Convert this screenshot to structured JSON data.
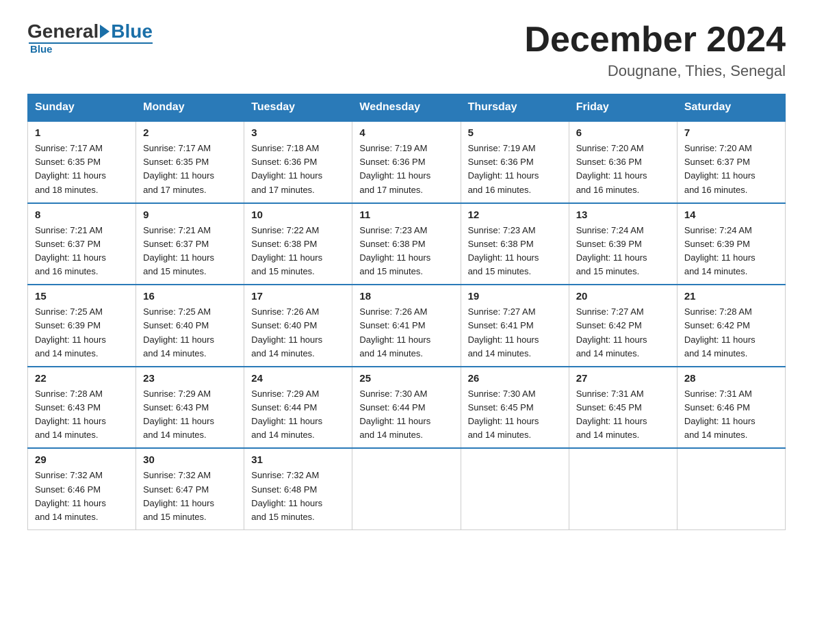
{
  "logo": {
    "general": "General",
    "blue": "Blue",
    "underline": "Blue"
  },
  "header": {
    "title": "December 2024",
    "location": "Dougnane, Thies, Senegal"
  },
  "days_of_week": [
    "Sunday",
    "Monday",
    "Tuesday",
    "Wednesday",
    "Thursday",
    "Friday",
    "Saturday"
  ],
  "weeks": [
    [
      {
        "day": "1",
        "sunrise": "7:17 AM",
        "sunset": "6:35 PM",
        "daylight": "11 hours and 18 minutes."
      },
      {
        "day": "2",
        "sunrise": "7:17 AM",
        "sunset": "6:35 PM",
        "daylight": "11 hours and 17 minutes."
      },
      {
        "day": "3",
        "sunrise": "7:18 AM",
        "sunset": "6:36 PM",
        "daylight": "11 hours and 17 minutes."
      },
      {
        "day": "4",
        "sunrise": "7:19 AM",
        "sunset": "6:36 PM",
        "daylight": "11 hours and 17 minutes."
      },
      {
        "day": "5",
        "sunrise": "7:19 AM",
        "sunset": "6:36 PM",
        "daylight": "11 hours and 16 minutes."
      },
      {
        "day": "6",
        "sunrise": "7:20 AM",
        "sunset": "6:36 PM",
        "daylight": "11 hours and 16 minutes."
      },
      {
        "day": "7",
        "sunrise": "7:20 AM",
        "sunset": "6:37 PM",
        "daylight": "11 hours and 16 minutes."
      }
    ],
    [
      {
        "day": "8",
        "sunrise": "7:21 AM",
        "sunset": "6:37 PM",
        "daylight": "11 hours and 16 minutes."
      },
      {
        "day": "9",
        "sunrise": "7:21 AM",
        "sunset": "6:37 PM",
        "daylight": "11 hours and 15 minutes."
      },
      {
        "day": "10",
        "sunrise": "7:22 AM",
        "sunset": "6:38 PM",
        "daylight": "11 hours and 15 minutes."
      },
      {
        "day": "11",
        "sunrise": "7:23 AM",
        "sunset": "6:38 PM",
        "daylight": "11 hours and 15 minutes."
      },
      {
        "day": "12",
        "sunrise": "7:23 AM",
        "sunset": "6:38 PM",
        "daylight": "11 hours and 15 minutes."
      },
      {
        "day": "13",
        "sunrise": "7:24 AM",
        "sunset": "6:39 PM",
        "daylight": "11 hours and 15 minutes."
      },
      {
        "day": "14",
        "sunrise": "7:24 AM",
        "sunset": "6:39 PM",
        "daylight": "11 hours and 14 minutes."
      }
    ],
    [
      {
        "day": "15",
        "sunrise": "7:25 AM",
        "sunset": "6:39 PM",
        "daylight": "11 hours and 14 minutes."
      },
      {
        "day": "16",
        "sunrise": "7:25 AM",
        "sunset": "6:40 PM",
        "daylight": "11 hours and 14 minutes."
      },
      {
        "day": "17",
        "sunrise": "7:26 AM",
        "sunset": "6:40 PM",
        "daylight": "11 hours and 14 minutes."
      },
      {
        "day": "18",
        "sunrise": "7:26 AM",
        "sunset": "6:41 PM",
        "daylight": "11 hours and 14 minutes."
      },
      {
        "day": "19",
        "sunrise": "7:27 AM",
        "sunset": "6:41 PM",
        "daylight": "11 hours and 14 minutes."
      },
      {
        "day": "20",
        "sunrise": "7:27 AM",
        "sunset": "6:42 PM",
        "daylight": "11 hours and 14 minutes."
      },
      {
        "day": "21",
        "sunrise": "7:28 AM",
        "sunset": "6:42 PM",
        "daylight": "11 hours and 14 minutes."
      }
    ],
    [
      {
        "day": "22",
        "sunrise": "7:28 AM",
        "sunset": "6:43 PM",
        "daylight": "11 hours and 14 minutes."
      },
      {
        "day": "23",
        "sunrise": "7:29 AM",
        "sunset": "6:43 PM",
        "daylight": "11 hours and 14 minutes."
      },
      {
        "day": "24",
        "sunrise": "7:29 AM",
        "sunset": "6:44 PM",
        "daylight": "11 hours and 14 minutes."
      },
      {
        "day": "25",
        "sunrise": "7:30 AM",
        "sunset": "6:44 PM",
        "daylight": "11 hours and 14 minutes."
      },
      {
        "day": "26",
        "sunrise": "7:30 AM",
        "sunset": "6:45 PM",
        "daylight": "11 hours and 14 minutes."
      },
      {
        "day": "27",
        "sunrise": "7:31 AM",
        "sunset": "6:45 PM",
        "daylight": "11 hours and 14 minutes."
      },
      {
        "day": "28",
        "sunrise": "7:31 AM",
        "sunset": "6:46 PM",
        "daylight": "11 hours and 14 minutes."
      }
    ],
    [
      {
        "day": "29",
        "sunrise": "7:32 AM",
        "sunset": "6:46 PM",
        "daylight": "11 hours and 14 minutes."
      },
      {
        "day": "30",
        "sunrise": "7:32 AM",
        "sunset": "6:47 PM",
        "daylight": "11 hours and 15 minutes."
      },
      {
        "day": "31",
        "sunrise": "7:32 AM",
        "sunset": "6:48 PM",
        "daylight": "11 hours and 15 minutes."
      },
      null,
      null,
      null,
      null
    ]
  ],
  "labels": {
    "sunrise": "Sunrise:",
    "sunset": "Sunset:",
    "daylight": "Daylight:"
  }
}
